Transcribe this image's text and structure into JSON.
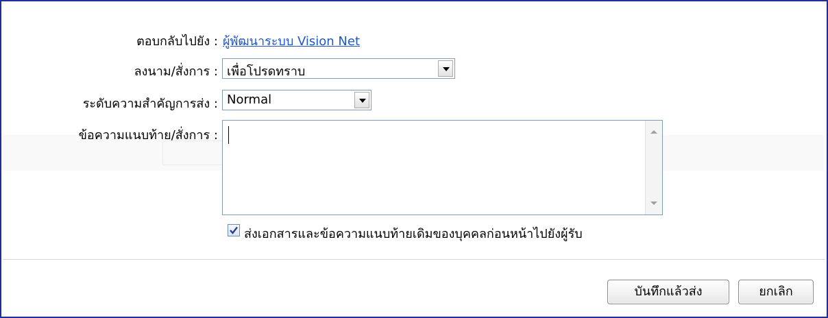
{
  "form": {
    "reply_to_label": "ตอบกลับไปยัง :",
    "reply_to_value": "ผู้พัฒนาระบบ Vision Net",
    "sign_label": "ลงนาม/สั่งการ :",
    "sign_value": "เพื่อโปรดทราบ",
    "priority_label": "ระดับความสำคัญการส่ง :",
    "priority_value": "Normal",
    "message_label": "ข้อความแนบท้าย/สั่งการ :",
    "message_value": "",
    "forward_checked": true,
    "forward_label": "ส่งเอกสารและข้อความแนบท้ายเดิมของบุคคลก่อนหน้าไปยังผู้รับ"
  },
  "actions": {
    "save_send": "บันทึกแล้วส่ง",
    "cancel": "ยกเลิก"
  },
  "colors": {
    "border": "#1f2f9a",
    "link": "#1f57c8"
  }
}
